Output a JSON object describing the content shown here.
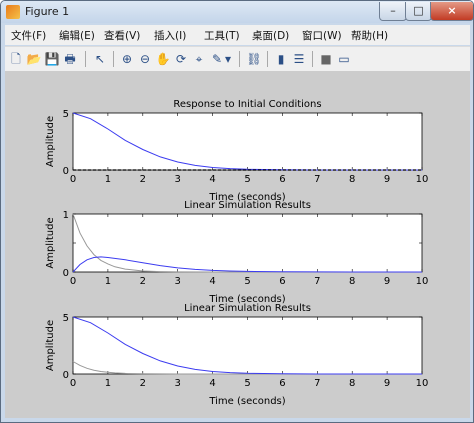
{
  "window": {
    "title": "Figure 1",
    "min_label": "–",
    "max_label": "□",
    "close_label": "×"
  },
  "menu": [
    "文件(F)",
    "编辑(E)",
    "查看(V)",
    "插入(I)",
    "工具(T)",
    "桌面(D)",
    "窗口(W)",
    "帮助(H)"
  ],
  "toolbar": {
    "icons": [
      "new-figure-icon",
      "open-file-icon",
      "save-icon",
      "print-icon",
      "pointer-icon",
      "zoom-in-icon",
      "zoom-out-icon",
      "pan-hand-icon",
      "rotate-3d-icon",
      "data-cursor-icon",
      "brush-icon",
      "brush-dropdown-icon",
      "link-plot-icon",
      "insert-colorbar-icon",
      "insert-legend-icon",
      "hide-plot-tools-icon",
      "show-plot-tools-icon"
    ],
    "glyphs": [
      "🗋",
      "📂",
      "💾",
      "🖶",
      "↖",
      "⊕",
      "⊖",
      "✋",
      "⟳",
      "⌖",
      "✎",
      "▾",
      "⛓",
      "▮",
      "☰",
      "■",
      "▭"
    ]
  },
  "chart_data": [
    {
      "type": "line",
      "title": "Response to Initial Conditions",
      "xlabel": "Time (seconds)",
      "ylabel": "Amplitude",
      "xlim": [
        0,
        10
      ],
      "ylim": [
        0,
        5
      ],
      "xticks": [
        0,
        1,
        2,
        3,
        4,
        5,
        6,
        7,
        8,
        9,
        10
      ],
      "yticks": [
        0,
        5
      ],
      "grid": false,
      "series": [
        {
          "color": "#3c3cf0",
          "x": [
            0,
            0.5,
            1,
            1.5,
            2,
            2.5,
            3,
            3.5,
            4,
            4.5,
            5,
            6,
            7,
            8,
            9,
            10
          ],
          "y": [
            5,
            4.5,
            3.6,
            2.6,
            1.8,
            1.15,
            0.7,
            0.4,
            0.22,
            0.12,
            0.06,
            0.015,
            0.004,
            0.001,
            0,
            0
          ]
        },
        {
          "color": "#000000",
          "dash": true,
          "x": [
            0,
            10
          ],
          "y": [
            0,
            0
          ]
        }
      ]
    },
    {
      "type": "line",
      "title": "Linear Simulation Results",
      "xlabel": "Time (seconds)",
      "ylabel": "Amplitude",
      "xlim": [
        0,
        10
      ],
      "ylim": [
        0,
        1
      ],
      "xticks": [
        0,
        1,
        2,
        3,
        4,
        5,
        6,
        7,
        8,
        9,
        10
      ],
      "yticks": [
        0,
        0.5,
        1
      ],
      "ytick_labels": [
        "0",
        "0.5",
        "1"
      ],
      "grid": false,
      "series": [
        {
          "color": "#999999",
          "x": [
            0,
            0.2,
            0.4,
            0.6,
            0.8,
            1,
            1.2,
            1.5,
            2,
            2.5,
            3,
            4,
            5,
            10
          ],
          "y": [
            1,
            0.67,
            0.45,
            0.3,
            0.2,
            0.14,
            0.09,
            0.05,
            0.018,
            0.007,
            0.002,
            0,
            0,
            0
          ]
        },
        {
          "color": "#3c3cf0",
          "x": [
            0,
            0.2,
            0.4,
            0.6,
            0.8,
            1,
            1.5,
            2,
            2.5,
            3,
            3.5,
            4,
            4.5,
            5,
            6,
            7,
            8,
            10
          ],
          "y": [
            0,
            0.13,
            0.21,
            0.25,
            0.26,
            0.25,
            0.21,
            0.16,
            0.11,
            0.07,
            0.045,
            0.028,
            0.017,
            0.01,
            0.004,
            0.001,
            0,
            0
          ]
        }
      ]
    },
    {
      "type": "line",
      "title": "Linear Simulation Results",
      "xlabel": "Time (seconds)",
      "ylabel": "Amplitude",
      "xlim": [
        0,
        10
      ],
      "ylim": [
        0,
        5
      ],
      "xticks": [
        0,
        1,
        2,
        3,
        4,
        5,
        6,
        7,
        8,
        9,
        10
      ],
      "yticks": [
        0,
        5
      ],
      "grid": false,
      "series": [
        {
          "color": "#999999",
          "x": [
            0,
            0.2,
            0.4,
            0.6,
            0.8,
            1,
            1.2,
            1.5,
            2,
            3,
            10
          ],
          "y": [
            1.1,
            0.75,
            0.5,
            0.33,
            0.22,
            0.15,
            0.1,
            0.05,
            0.015,
            0.002,
            0
          ]
        },
        {
          "color": "#3c3cf0",
          "x": [
            0,
            0.5,
            1,
            1.5,
            2,
            2.5,
            3,
            3.5,
            4,
            4.5,
            5,
            6,
            7,
            8,
            9,
            10
          ],
          "y": [
            5,
            4.5,
            3.6,
            2.6,
            1.8,
            1.15,
            0.7,
            0.4,
            0.22,
            0.12,
            0.06,
            0.015,
            0.004,
            0.001,
            0,
            0
          ]
        }
      ]
    }
  ]
}
